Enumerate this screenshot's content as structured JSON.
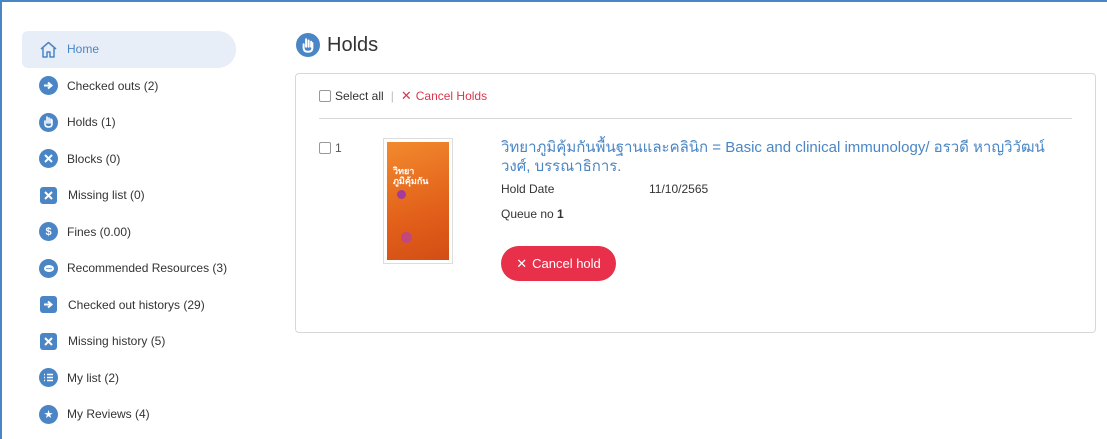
{
  "sidebar": {
    "items": [
      {
        "label": "Home",
        "icon": "home-icon"
      },
      {
        "label": "Checked outs (2)",
        "icon": "arrow-right-circle-icon"
      },
      {
        "label": "Holds (1)",
        "icon": "hand-icon"
      },
      {
        "label": "Blocks (0)",
        "icon": "x-circle-icon"
      },
      {
        "label": "Missing list (0)",
        "icon": "x-square-icon"
      },
      {
        "label": "Fines (0.00)",
        "icon": "dollar-icon"
      },
      {
        "label": "Recommended Resources (3)",
        "icon": "chat-icon"
      },
      {
        "label": "Checked out historys (29)",
        "icon": "arrow-right-square-icon"
      },
      {
        "label": "Missing history (5)",
        "icon": "x-square-icon"
      },
      {
        "label": "My list (2)",
        "icon": "list-icon"
      },
      {
        "label": "My Reviews (4)",
        "icon": "star-icon"
      }
    ]
  },
  "page": {
    "title": "Holds"
  },
  "toolbar": {
    "select_all": "Select all",
    "separator": "|",
    "cancel_holds": "Cancel Holds"
  },
  "hold_item": {
    "index": "1",
    "title": "วิทยาภูมิคุ้มกันพื้นฐานและคลินิก = Basic and clinical immunology/ อรวดี หาญวิวัฒน์วงศ์, บรรณาธิการ.",
    "cover_text": "วิทยาภูมิคุ้มกัน",
    "hold_date_label": "Hold Date",
    "hold_date_value": "11/10/2565",
    "queue_label": "Queue no",
    "queue_value": "1",
    "cancel_button": "Cancel hold"
  },
  "colors": {
    "accent": "#4a86c5",
    "danger": "#e8304a",
    "active_bg": "#e8eef8"
  }
}
